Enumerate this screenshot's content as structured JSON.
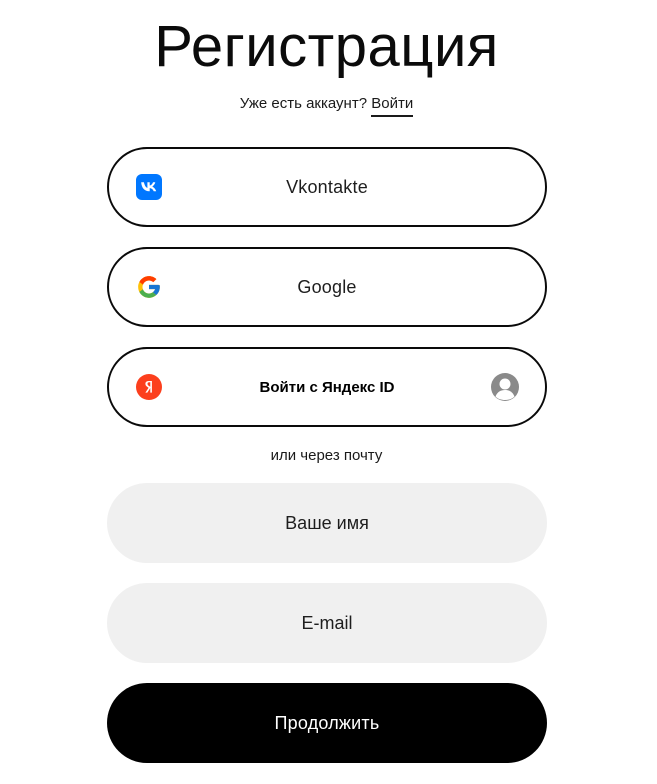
{
  "page": {
    "title": "Регистрация",
    "signin_prompt": "Уже есть аккаунт?",
    "signin_link": "Войти"
  },
  "social": {
    "vk": {
      "label": "Vkontakte",
      "icon": "vk-logo-icon",
      "color": "#0077FF"
    },
    "google": {
      "label": "Google",
      "icon": "google-logo-icon"
    },
    "yandex": {
      "label": "Войти с Яндекс ID",
      "icon": "yandex-logo-icon",
      "color": "#FC3F1D",
      "avatar_icon": "user-avatar-icon"
    }
  },
  "divider_text": "или через почту",
  "form": {
    "name_placeholder": "Ваше имя",
    "email_placeholder": "E-mail",
    "submit_label": "Продолжить"
  },
  "colors": {
    "primary": "#000000",
    "field_bg": "#F0F0F0",
    "background": "#FFFFFF"
  }
}
